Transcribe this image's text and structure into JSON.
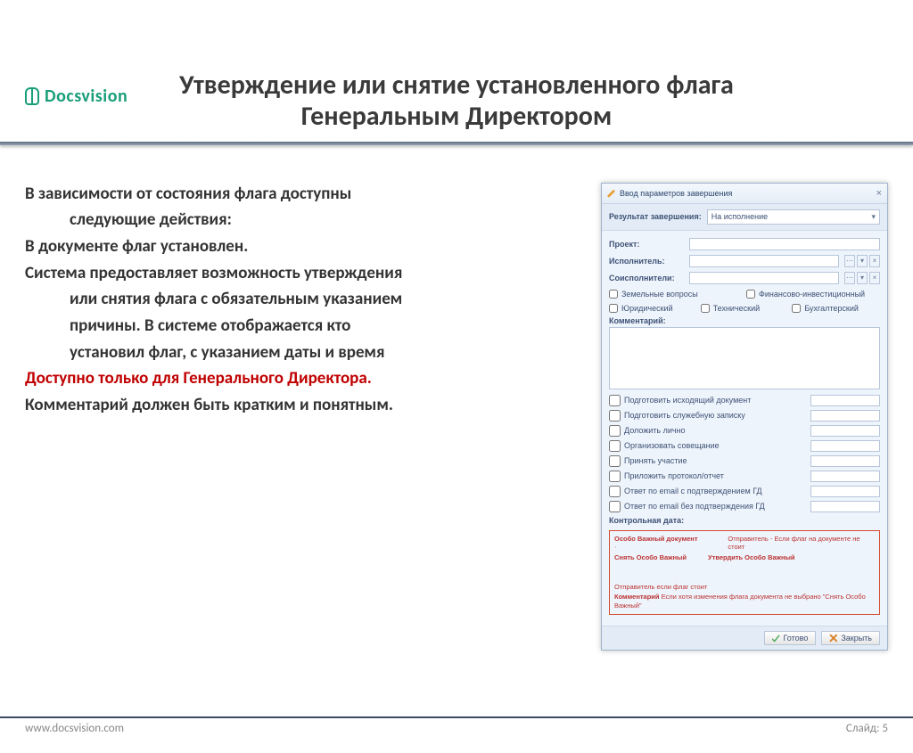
{
  "brand": {
    "name": "Docsvision"
  },
  "title_line1": "Утверждение или снятие  установленного флага",
  "title_line2": "Генеральным Директором",
  "body": {
    "p1a": "В зависимости от состояния флага доступны",
    "p1b": "следующие действия:",
    "p2": "В документе флаг  установлен.",
    "p3a": "Система предоставляет возможность утверждения",
    "p3b": "или снятия флага с обязательным указанием",
    "p3c": "причины. В системе отображается кто",
    "p3d": "установил флаг, с указанием даты и время",
    "p4": "Доступно только для Генерального Директора.",
    "p5": "Комментарий должен быть кратким и понятным."
  },
  "dialog": {
    "title": "Ввод параметров завершения",
    "result_label": "Результат завершения:",
    "result_value": "На исполнение",
    "fields": {
      "project": "Проект:",
      "executor": "Исполнитель:",
      "coexecutors": "Соисполнители:"
    },
    "topic_checks": [
      "Земельные вопросы",
      "Финансово-инвестиционный",
      "Юридический",
      "Технический",
      "Бухгалтерский"
    ],
    "comment_label": "Комментарий:",
    "tasks": [
      "Подготовить исходящий документ",
      "Подготовить служебную записку",
      "Доложить лично",
      "Организовать совещание",
      "Принять участие",
      "Приложить протокол/отчет",
      "Ответ по email с подтверждением ГД",
      "Ответ по email без подтверждения ГД"
    ],
    "control_date_label": "Контрольная дата:",
    "redbox": {
      "l1a": "Особо Важный документ",
      "l1b": "Отправитель - Если флаг на документе не стоит",
      "l2a": "Снять Особо Важный",
      "l2b": "Утвердить Особо Важный",
      "l2c": "Отправитель если флаг стоит",
      "l3lab": "Комментарий",
      "l3": "Если хотя изменения флага документа не выбрано \"Снять Особо Важный\""
    },
    "btn_ok": "Готово",
    "btn_cancel": "Закрыть"
  },
  "footer": {
    "url": "www.docsvision.com",
    "slide": "Слайд: 5"
  }
}
